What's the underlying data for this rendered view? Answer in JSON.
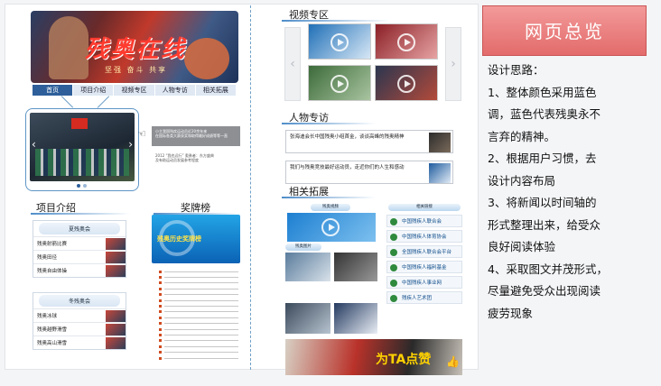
{
  "left": {
    "banner": {
      "title": "残奥在线",
      "subtitle": "坚强 奋斗 共享"
    },
    "nav": [
      "首页",
      "项目介绍",
      "视频专区",
      "人物专访",
      "相关拓展"
    ],
    "note_box": [
      "小主我国残疾运动员近20余年来",
      "在国际各类大赛获奖和取得最好成绩等等一直"
    ],
    "note_text": [
      "2012 “我也远行” 奥勇者：东方盛典",
      "及有助运动员发展参考程度"
    ],
    "section_project": "项目介绍",
    "section_medal": "奖牌榜",
    "summer_head": "夏残奥会",
    "summer_items": [
      "残奥射箭比赛",
      "残奥田径",
      "残奥自由体操"
    ],
    "winter_head": "冬残奥会",
    "winter_items": [
      "残奥冰球",
      "残奥越野滑雪",
      "残奥高山滑雪"
    ],
    "medal_banner": "残奥历史奖牌榜"
  },
  "middle": {
    "section_video": "视频专区",
    "section_people": "人物专访",
    "section_ext": "相关拓展",
    "people": [
      "张海迪会长中国残奥小组首金，谈谈高峰的残奥精神",
      "我们与残奥竞技最好运动员，走近你们的人生和感动"
    ],
    "ext_pills": [
      "残奥视频",
      "残奥图片",
      "相关链接"
    ],
    "links": [
      "中国残疾人联合会",
      "中国残疾人体育协会",
      "全国残疾人联合会平台",
      "中国残疾人福利基金",
      "中国残疾人事业网",
      "残疾人艺术团"
    ],
    "ta_text": "为TA点赞"
  },
  "right": {
    "overview": "网页总览",
    "design": [
      "设计思路：",
      "1、整体颜色采用蓝色",
      "调，蓝色代表残奥永不",
      "言弃的精神。",
      "2、根据用户习惯，去",
      "设计内容布局",
      "3、将新闻以时间轴的",
      "形式整理出来，给受众",
      "良好阅读体验",
      "4、采取图文并茂形式，",
      "尽量避免受众出现阅读",
      "疲劳现象"
    ]
  },
  "colors": {
    "accent": "#2e5f9a",
    "line": "#6fa0c8",
    "overview": "#e36b6b"
  }
}
